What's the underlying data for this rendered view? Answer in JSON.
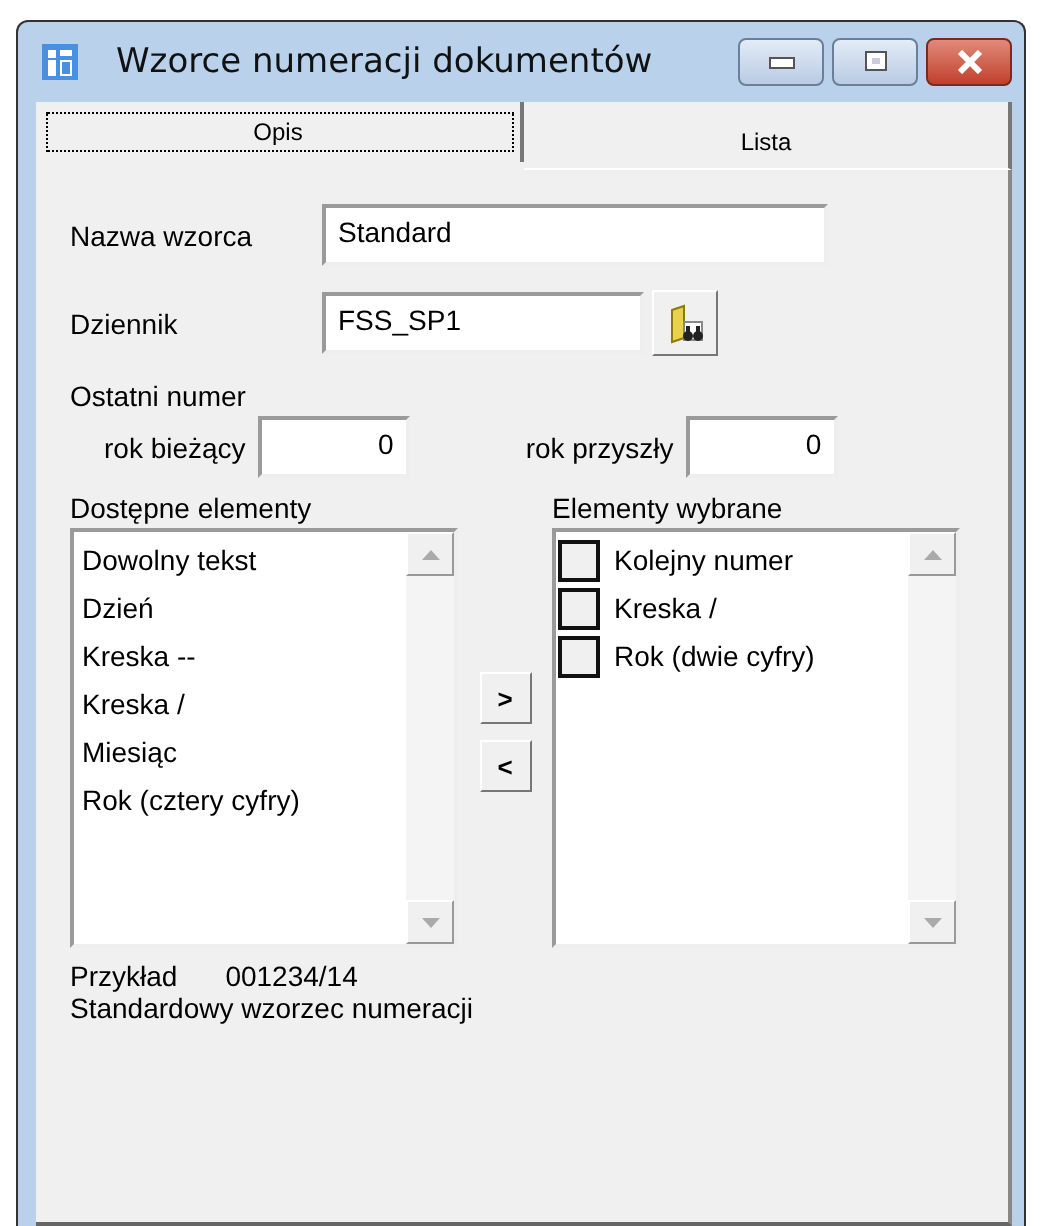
{
  "window": {
    "title": "Wzorce numeracji dokumentów"
  },
  "tabs": [
    {
      "label": "Opis",
      "selected": true
    },
    {
      "label": "Lista",
      "selected": false
    }
  ],
  "form": {
    "name_label": "Nazwa wzorca",
    "name_value": "Standard",
    "journal_label": "Dziennik",
    "journal_value": "FSS_SP1",
    "last_number_label": "Ostatni numer",
    "current_year_label": "rok bieżący",
    "current_year_value": "0",
    "next_year_label": "rok przyszły",
    "next_year_value": "0"
  },
  "available": {
    "label": "Dostępne elementy",
    "items": [
      "Dowolny tekst",
      "Dzień",
      "Kreska --",
      "Kreska /",
      "Miesiąc",
      "Rok (cztery cyfry)"
    ]
  },
  "move_buttons": [
    ">",
    "<"
  ],
  "chosen": {
    "label": "Elementy wybrane",
    "items": [
      {
        "text": "Kolejny numer",
        "checked": false
      },
      {
        "text": "Kreska /",
        "checked": false
      },
      {
        "text": "Rok (dwie cyfry)",
        "checked": false
      }
    ]
  },
  "example": {
    "label": "Przykład",
    "value": "001234/14"
  },
  "description": "Standardowy wzorzec numeracji"
}
